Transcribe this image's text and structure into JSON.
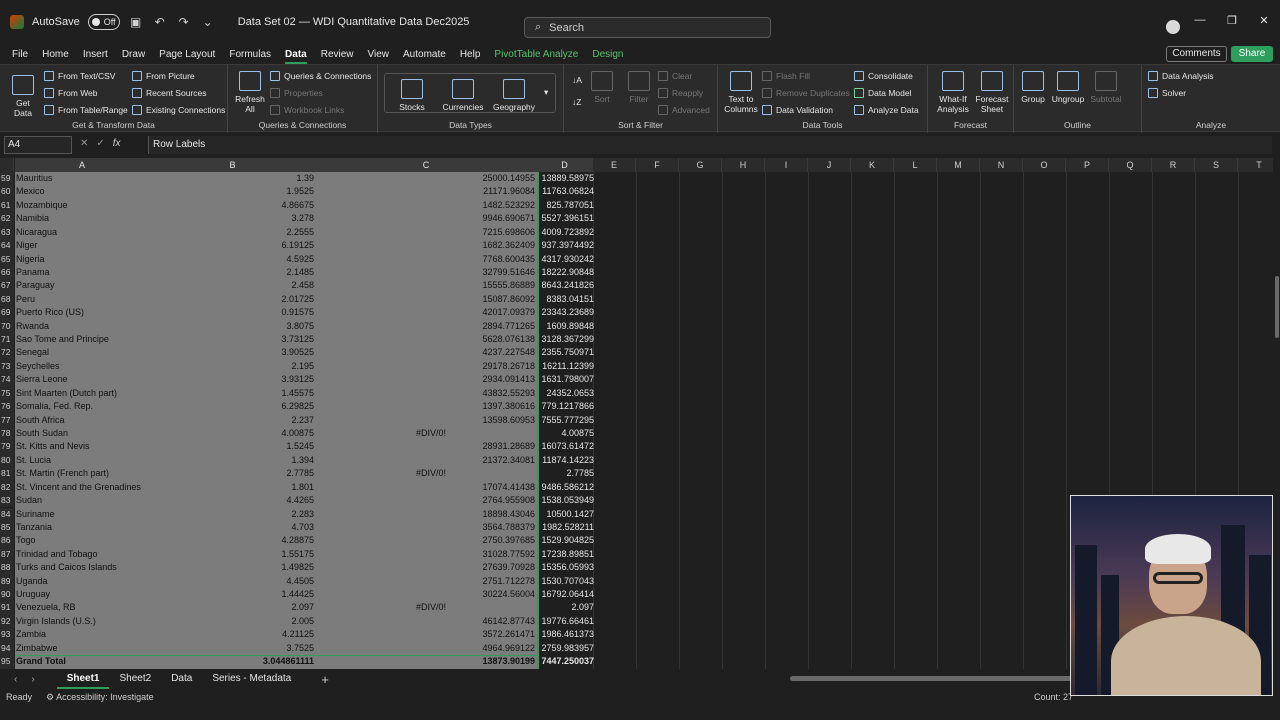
{
  "titlebar": {
    "autosave_label": "AutoSave",
    "autosave_state": "Off",
    "doc_title": "Data Set 02 — WDI Quantitative Data Dec2025",
    "search_placeholder": "Search"
  },
  "menu": {
    "tabs": [
      "File",
      "Home",
      "Insert",
      "Draw",
      "Page Layout",
      "Formulas",
      "Data",
      "Review",
      "View",
      "Automate",
      "Help",
      "PivotTable Analyze",
      "Design"
    ],
    "active": "Data",
    "comments_label": "Comments",
    "share_label": "Share"
  },
  "ribbon": {
    "get_transform": {
      "label": "Get & Transform Data",
      "get_data": "Get Data",
      "from_text_csv": "From Text/CSV",
      "from_web": "From Web",
      "from_table_range": "From Table/Range",
      "from_picture": "From Picture",
      "recent_sources": "Recent Sources",
      "existing_connections": "Existing Connections"
    },
    "queries": {
      "label": "Queries & Connections",
      "refresh_all": "Refresh All",
      "queries_connections": "Queries & Connections",
      "properties": "Properties",
      "workbook_links": "Workbook Links"
    },
    "data_types": {
      "label": "Data Types",
      "stocks": "Stocks",
      "currencies": "Currencies",
      "geography": "Geography"
    },
    "sort_filter": {
      "label": "Sort & Filter",
      "sort": "Sort",
      "filter": "Filter",
      "clear": "Clear",
      "reapply": "Reapply",
      "advanced": "Advanced"
    },
    "data_tools": {
      "label": "Data Tools",
      "text_to_columns": "Text to Columns",
      "flash_fill": "Flash Fill",
      "remove_duplicates": "Remove Duplicates",
      "data_validation": "Data Validation",
      "consolidate": "Consolidate",
      "data_model": "Data Model",
      "analyze_data": "Analyze Data"
    },
    "forecast": {
      "label": "Forecast",
      "what_if": "What-If Analysis",
      "forecast_sheet": "Forecast Sheet"
    },
    "outline": {
      "label": "Outline",
      "group": "Group",
      "ungroup": "Ungroup",
      "subtotal": "Subtotal"
    },
    "analyze": {
      "label": "Analyze",
      "data_analysis": "Data Analysis",
      "solver": "Solver"
    }
  },
  "formula_bar": {
    "name_box": "A4",
    "fx": "fx",
    "content": "Row Labels"
  },
  "columns": [
    "A",
    "B",
    "C",
    "D",
    "E",
    "F",
    "G",
    "H",
    "I",
    "J",
    "K",
    "L",
    "M",
    "N",
    "O",
    "P",
    "Q",
    "R",
    "S",
    "T"
  ],
  "rows": [
    {
      "n": "59",
      "a": "Mauritius",
      "b": "1.39",
      "c": "25000.14955",
      "d": "13889.58975"
    },
    {
      "n": "60",
      "a": "Mexico",
      "b": "1.9525",
      "c": "21171.96084",
      "d": "11763.06824"
    },
    {
      "n": "61",
      "a": "Mozambique",
      "b": "4.86675",
      "c": "1482.523292",
      "d": "825.787051"
    },
    {
      "n": "62",
      "a": "Namibia",
      "b": "3.278",
      "c": "9946.690671",
      "d": "5527.396151"
    },
    {
      "n": "63",
      "a": "Nicaragua",
      "b": "2.2555",
      "c": "7215.698606",
      "d": "4009.723892"
    },
    {
      "n": "64",
      "a": "Niger",
      "b": "6.19125",
      "c": "1682.362409",
      "d": "937.3974492"
    },
    {
      "n": "65",
      "a": "Nigeria",
      "b": "4.5925",
      "c": "7768.600435",
      "d": "4317.930242"
    },
    {
      "n": "66",
      "a": "Panama",
      "b": "2.1485",
      "c": "32799.51646",
      "d": "18222.90848"
    },
    {
      "n": "67",
      "a": "Paraguay",
      "b": "2.458",
      "c": "15555.86889",
      "d": "8643.241826"
    },
    {
      "n": "68",
      "a": "Peru",
      "b": "2.01725",
      "c": "15087.86092",
      "d": "8383.04151"
    },
    {
      "n": "69",
      "a": "Puerto Rico (US)",
      "b": "0.91575",
      "c": "42017.09379",
      "d": "23343.23689"
    },
    {
      "n": "70",
      "a": "Rwanda",
      "b": "3.8075",
      "c": "2894.771265",
      "d": "1609.89848"
    },
    {
      "n": "71",
      "a": "Sao Tome and Principe",
      "b": "3.73125",
      "c": "5628.076138",
      "d": "3128.367299"
    },
    {
      "n": "72",
      "a": "Senegal",
      "b": "3.90525",
      "c": "4237.227548",
      "d": "2355.750971"
    },
    {
      "n": "73",
      "a": "Seychelles",
      "b": "2.195",
      "c": "29178.26718",
      "d": "16211.12399"
    },
    {
      "n": "74",
      "a": "Sierra Leone",
      "b": "3.93125",
      "c": "2934.091413",
      "d": "1631.798007"
    },
    {
      "n": "75",
      "a": "Sint Maarten (Dutch part)",
      "b": "1.45575",
      "c": "43832.55293",
      "d": "24352.0653"
    },
    {
      "n": "76",
      "a": "Somalia, Fed. Rep.",
      "b": "6.29825",
      "c": "1397.380616",
      "d": "779.1217866"
    },
    {
      "n": "77",
      "a": "South Africa",
      "b": "2.237",
      "c": "13598.60953",
      "d": "7555.777295"
    },
    {
      "n": "78",
      "a": "South Sudan",
      "b": "4.00875",
      "c": "#DIV/0!",
      "d": "4.00875",
      "err": true
    },
    {
      "n": "79",
      "a": "St. Kitts and Nevis",
      "b": "1.5245",
      "c": "28931.28689",
      "d": "16073.61472"
    },
    {
      "n": "80",
      "a": "St. Lucia",
      "b": "1.394",
      "c": "21372.34081",
      "d": "11874.14223"
    },
    {
      "n": "81",
      "a": "St. Martin (French part)",
      "b": "2.7785",
      "c": "#DIV/0!",
      "d": "2.7785",
      "err": true
    },
    {
      "n": "82",
      "a": "St. Vincent and the Grenadines",
      "b": "1.801",
      "c": "17074.41438",
      "d": "9486.586212"
    },
    {
      "n": "83",
      "a": "Sudan",
      "b": "4.4265",
      "c": "2764.955908",
      "d": "1538.053949"
    },
    {
      "n": "84",
      "a": "Suriname",
      "b": "2.283",
      "c": "18898.43046",
      "d": "10500.1427"
    },
    {
      "n": "85",
      "a": "Tanzania",
      "b": "4.703",
      "c": "3564.788379",
      "d": "1982.528211"
    },
    {
      "n": "86",
      "a": "Togo",
      "b": "4.28875",
      "c": "2750.397685",
      "d": "1529.904825"
    },
    {
      "n": "87",
      "a": "Trinidad and Tobago",
      "b": "1.55175",
      "c": "31028.77592",
      "d": "17238.89851"
    },
    {
      "n": "88",
      "a": "Turks and Caicos Islands",
      "b": "1.49825",
      "c": "27639.70928",
      "d": "15356.05993"
    },
    {
      "n": "89",
      "a": "Uganda",
      "b": "4.4505",
      "c": "2751.712278",
      "d": "1530.707043"
    },
    {
      "n": "90",
      "a": "Uruguay",
      "b": "1.44425",
      "c": "30224.56004",
      "d": "16792.06414"
    },
    {
      "n": "91",
      "a": "Venezuela, RB",
      "b": "2.097",
      "c": "#DIV/0!",
      "d": "2.097",
      "err": true
    },
    {
      "n": "92",
      "a": "Virgin Islands (U.S.)",
      "b": "2.005",
      "c": "46142.87743",
      "d": "19776.66461"
    },
    {
      "n": "93",
      "a": "Zambia",
      "b": "4.21125",
      "c": "3572.261471",
      "d": "1986.461373"
    },
    {
      "n": "94",
      "a": "Zimbabwe",
      "b": "3.7525",
      "c": "4964.969122",
      "d": "2759.983957"
    },
    {
      "n": "95",
      "a": "Grand Total",
      "b": "3.044861111",
      "c": "13873.90199",
      "d": "7447.250037",
      "bold": true
    }
  ],
  "sheets": {
    "tabs": [
      "Sheet1",
      "Sheet2",
      "Data",
      "Series - Metadata"
    ],
    "active": "Sheet1"
  },
  "status": {
    "ready": "Ready",
    "accessibility": "Accessibility: Investigate",
    "count": "Count: 27"
  }
}
